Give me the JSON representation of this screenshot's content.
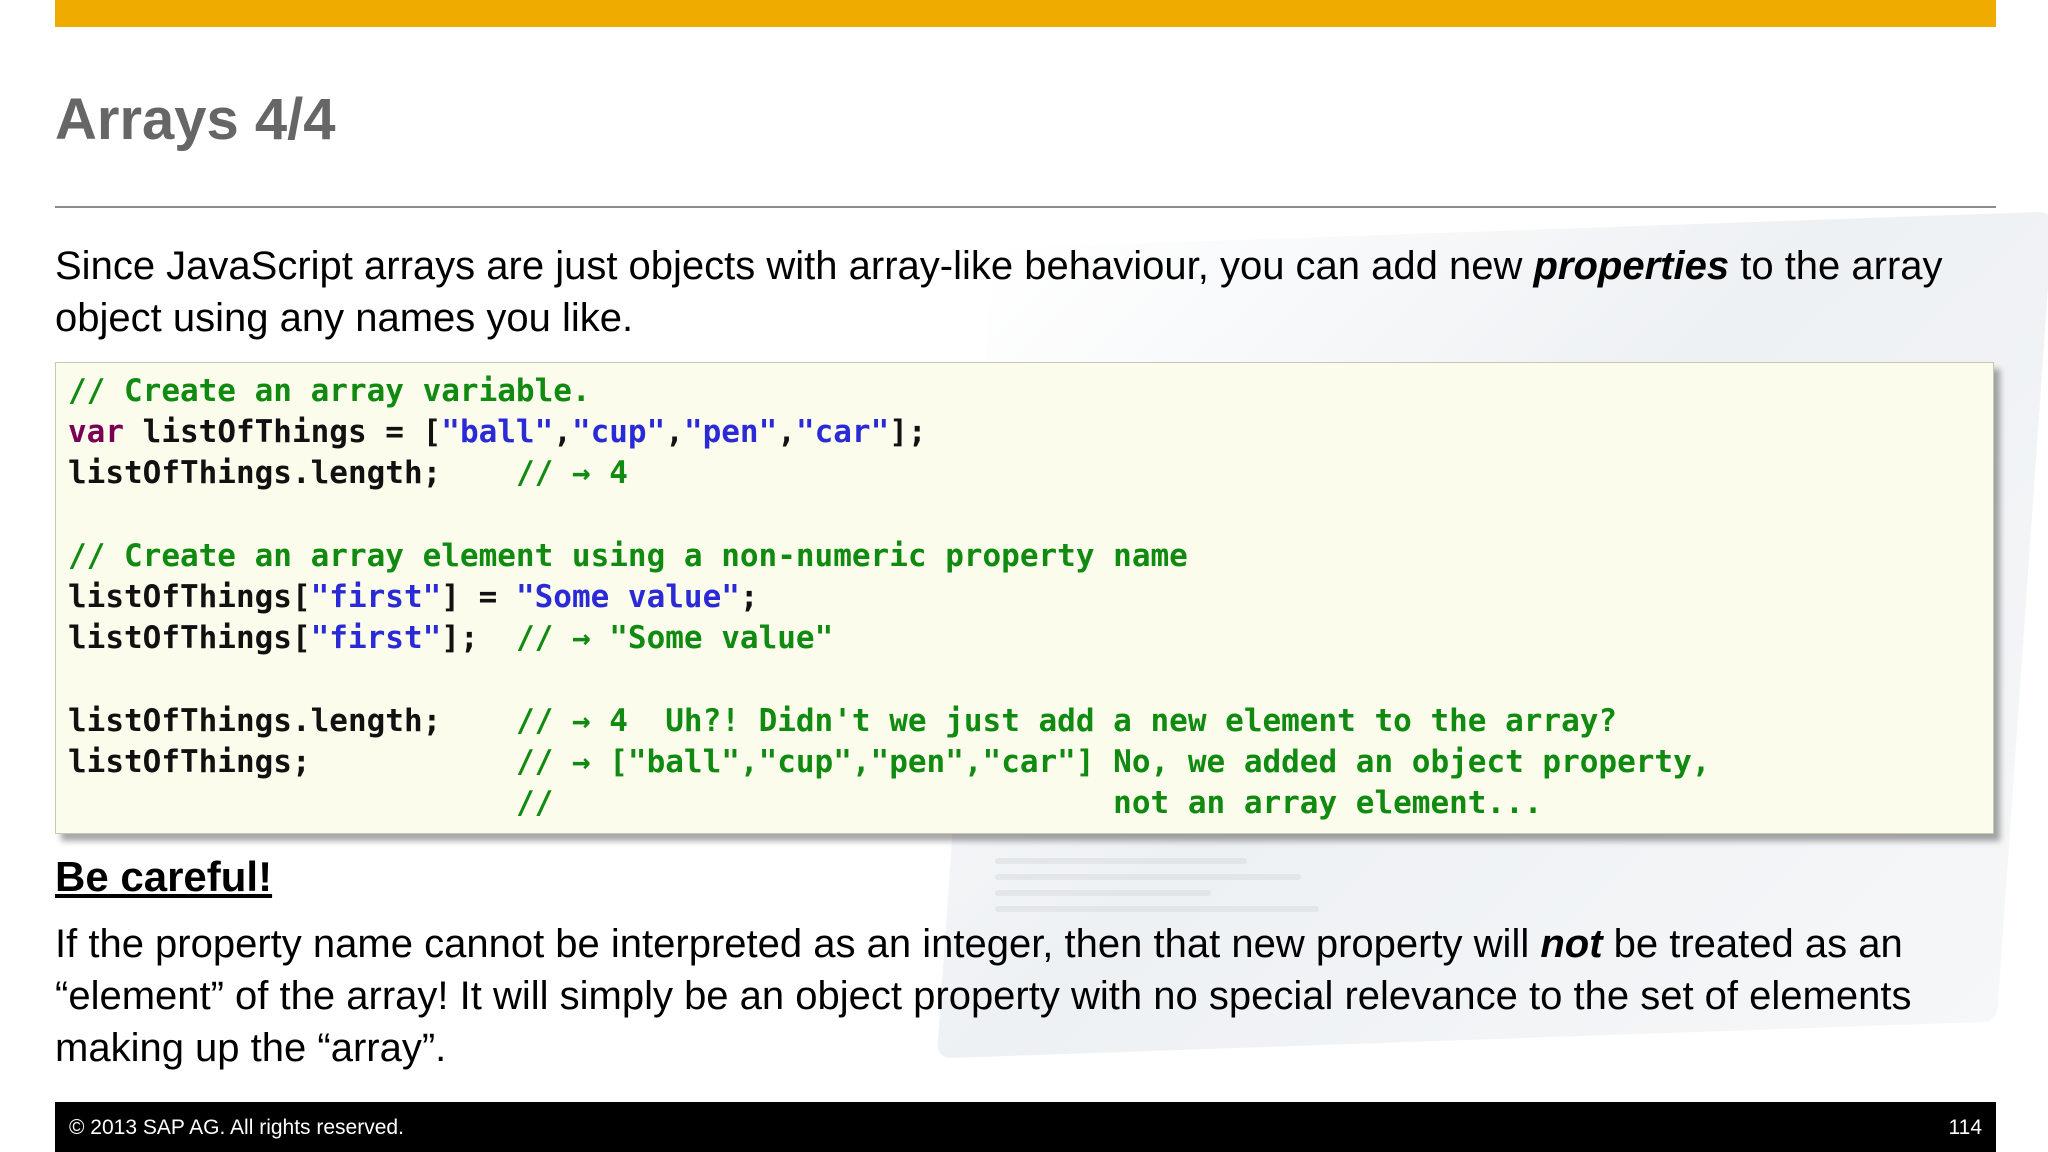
{
  "slide": {
    "title": "Arrays 4/4",
    "intro_before": "Since JavaScript arrays are just objects with array-like behaviour, you can add new ",
    "intro_emph": "properties",
    "intro_after": " to the array object using any names you like.",
    "code": {
      "l1_comment": "// Create an array variable.",
      "l2_keyword": "var",
      "l2_text": " listOfThings = [",
      "l2_s1": "\"ball\"",
      "l2_sep1": ",",
      "l2_s2": "\"cup\"",
      "l2_sep2": ",",
      "l2_s3": "\"pen\"",
      "l2_sep3": ",",
      "l2_s4": "\"car\"",
      "l2_end": "];",
      "l3_text": "listOfThings.length;    ",
      "l3_comment": "// → 4",
      "l5_comment": "// Create an array element using a non-numeric property name",
      "l6_text": "listOfThings[",
      "l6_key": "\"first\"",
      "l6_mid": "] = ",
      "l6_val": "\"Some value\"",
      "l6_end": ";",
      "l7_text": "listOfThings[",
      "l7_key": "\"first\"",
      "l7_mid": "];  ",
      "l7_comment": "// → \"Some value\"",
      "l9_text": "listOfThings.length;    ",
      "l9_comment": "// → 4  Uh?! Didn't we just add a new element to the array?",
      "l10_text": "listOfThings;           ",
      "l10_comment": "// → [\"ball\",\"cup\",\"pen\",\"car\"] No, we added an object property,",
      "l11_pad": "                        ",
      "l11_comment": "//                              not an array element..."
    },
    "careful_heading": "Be careful!",
    "explain_before": "If the property name cannot be interpreted as an integer, then that new property will ",
    "explain_emph": "not",
    "explain_after": " be treated as an “element” of the array!  It will simply be an object property with no special relevance to the set of elements making up the “array”."
  },
  "footer": {
    "copyright": "©  2013 SAP AG. All rights reserved.",
    "page_number": "114"
  },
  "colors": {
    "accent_bar": "#f0ab00",
    "title": "#666666",
    "code_comment": "#108a10",
    "code_keyword": "#7a0055",
    "code_string": "#2a2ad6",
    "code_background": "#fbfceb"
  }
}
